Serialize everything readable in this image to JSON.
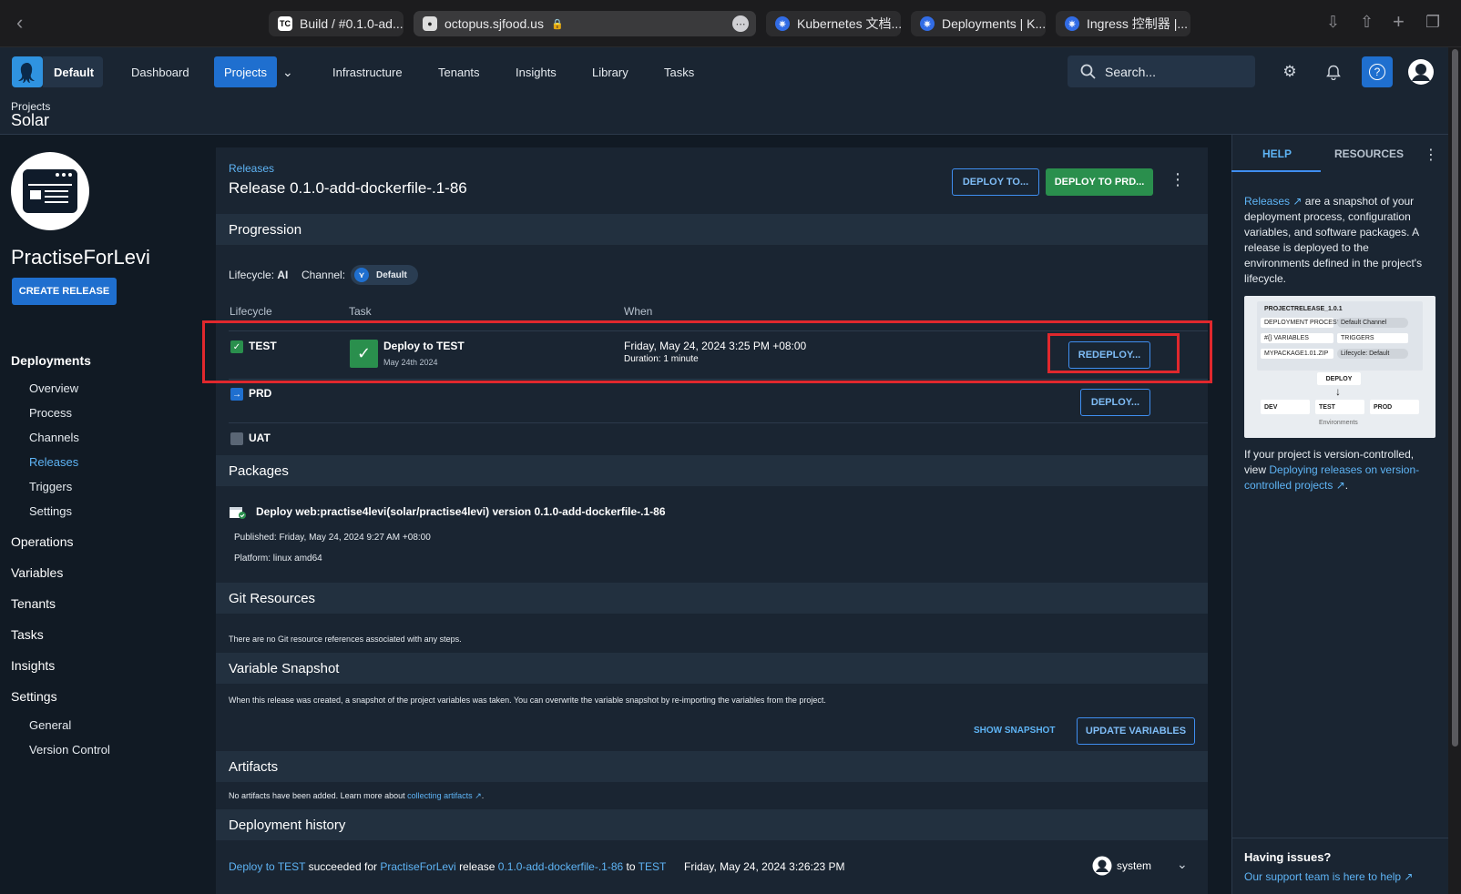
{
  "browser": {
    "tabs": [
      {
        "label": "Build / #0.1.0-ad...",
        "icon": "teamcity-icon"
      },
      {
        "label": "octopus.sjfood.us",
        "icon": "octopus-favicon"
      },
      {
        "label": "Kubernetes 文档...",
        "icon": "kubernetes-icon"
      },
      {
        "label": "Deployments | K...",
        "icon": "kubernetes-icon"
      },
      {
        "label": "Ingress 控制器 |...",
        "icon": "kubernetes-icon"
      }
    ]
  },
  "topnav": {
    "space": "Default",
    "links": [
      "Dashboard",
      "Projects",
      "Infrastructure",
      "Tenants",
      "Insights",
      "Library",
      "Tasks"
    ],
    "active": "Projects",
    "search_placeholder": "Search..."
  },
  "breadcrumb": {
    "parent": "Projects",
    "current": "Solar"
  },
  "sidebar": {
    "project_name": "PractiseForLevi",
    "create_release": "CREATE RELEASE",
    "deployments": "Deployments",
    "deployment_items": [
      "Overview",
      "Process",
      "Channels",
      "Releases",
      "Triggers",
      "Settings"
    ],
    "active_item": "Releases",
    "operations": "Operations",
    "variables": "Variables",
    "tenants": "Tenants",
    "tasks": "Tasks",
    "insights": "Insights",
    "settings": "Settings",
    "settings_items": [
      "General",
      "Version Control"
    ]
  },
  "release": {
    "crumb": "Releases",
    "title": "Release 0.1.0-add-dockerfile-.1-86",
    "deploy_to": "DEPLOY TO...",
    "deploy_to_prd": "DEPLOY TO PRD..."
  },
  "progression": {
    "heading": "Progression",
    "lifecycle_label": "Lifecycle:",
    "lifecycle_value": "AI",
    "channel_label": "Channel:",
    "channel_value": "Default",
    "columns": [
      "Lifecycle",
      "Task",
      "When"
    ],
    "rows": [
      {
        "env": "TEST",
        "task": "Deploy to TEST",
        "task_date": "May 24th 2024",
        "when": "Friday, May 24, 2024 3:25 PM +08:00",
        "duration": "Duration: 1 minute",
        "action": "REDEPLOY..."
      },
      {
        "env": "PRD",
        "action": "DEPLOY..."
      },
      {
        "env": "UAT"
      }
    ]
  },
  "packages": {
    "heading": "Packages",
    "deploy_line": "Deploy web:practise4levi(solar/practise4levi) version 0.1.0-add-dockerfile-.1-86",
    "published": "Published: Friday, May 24, 2024 9:27 AM +08:00",
    "platform": "Platform: linux amd64"
  },
  "git": {
    "heading": "Git Resources",
    "text": "There are no Git resource references associated with any steps."
  },
  "variables": {
    "heading": "Variable Snapshot",
    "text": "When this release was created, a snapshot of the project variables was taken. You can overwrite the variable snapshot by re-importing the variables from the project.",
    "show": "SHOW SNAPSHOT",
    "update": "UPDATE VARIABLES"
  },
  "artifacts": {
    "heading": "Artifacts",
    "text": "No artifacts have been added. Learn more about",
    "link": "collecting artifacts"
  },
  "history": {
    "heading": "Deployment history",
    "task": "Deploy to TEST",
    "succeeded": "succeeded for",
    "project": "PractiseForLevi",
    "release_word": "release",
    "release": "0.1.0-add-dockerfile-.1-86",
    "to": "to",
    "env": "TEST",
    "time": "Friday, May 24, 2024 3:26:23 PM",
    "user": "system"
  },
  "help": {
    "tabs": [
      "HELP",
      "RESOURCES"
    ],
    "intro_link": "Releases",
    "intro": "are a snapshot of your deployment process, configuration variables, and software packages. A release is deployed to the environments defined in the project's lifecycle.",
    "diagram": {
      "title": "PROJECTRELEASE_1.0.1",
      "process": "DEPLOYMENT PROCESS",
      "channel": "Default Channel",
      "vars": "#{} VARIABLES",
      "triggers": "TRIGGERS",
      "package": "MYPACKAGE1.01.ZIP",
      "lifecycle": "Lifecycle: Default",
      "deploy": "DEPLOY",
      "envs": [
        "DEV",
        "TEST",
        "PROD"
      ],
      "envs_label": "Environments"
    },
    "vc_text": "If your project is version-controlled, view",
    "vc_link": "Deploying releases on version-controlled projects",
    "issues_title": "Having issues?",
    "issues_link": "Our support team is here to help"
  },
  "colors": {
    "accent": "#1f6fcf",
    "success": "#2a8f4d",
    "link": "#5eb4f5",
    "highlight": "#e0282d"
  }
}
